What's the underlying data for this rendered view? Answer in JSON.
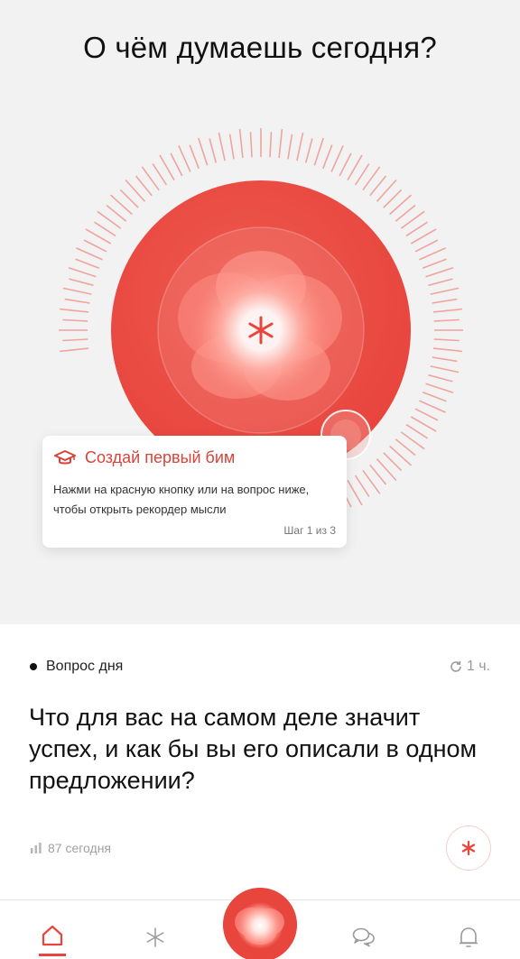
{
  "header": {
    "title": "О чём думаешь сегодня?"
  },
  "recorder": {
    "center_icon": "asterisk-icon",
    "accent_color": "#e8463d"
  },
  "tooltip": {
    "icon": "graduation-cap-icon",
    "title": "Создай первый бим",
    "text": "Нажми на красную кнопку или на вопрос ниже, чтобы открыть рекордер мысли",
    "step": "Шаг 1 из 3"
  },
  "question": {
    "label": "Вопрос дня",
    "time": "1 ч.",
    "time_icon": "refresh-icon",
    "text": "Что для вас на самом деле значит успех, и как бы вы его описали в одном предложении?",
    "stats": "87 сегодня",
    "stats_icon": "bar-chart-icon",
    "record_icon": "asterisk-icon"
  },
  "nav": {
    "items": [
      {
        "name": "home",
        "icon": "home-icon",
        "active": true
      },
      {
        "name": "feed",
        "icon": "asterisk-icon",
        "active": false
      },
      {
        "name": "record",
        "icon": "record-orb-icon",
        "active": false
      },
      {
        "name": "chats",
        "icon": "chat-bubbles-icon",
        "active": false
      },
      {
        "name": "notifications",
        "icon": "bell-icon",
        "active": false
      }
    ]
  }
}
